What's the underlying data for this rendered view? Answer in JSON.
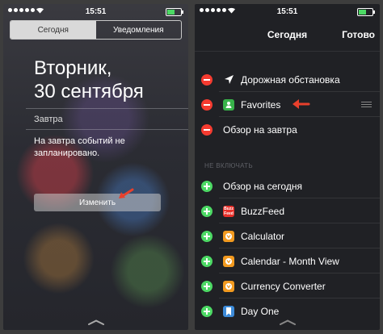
{
  "status_bar": {
    "time": "15:51"
  },
  "left_screen": {
    "tabs": [
      {
        "label": "Сегодня",
        "active": true
      },
      {
        "label": "Уведомления",
        "active": false
      }
    ],
    "date": {
      "weekday": "Вторник,",
      "day": "30 сентября"
    },
    "tomorrow": {
      "title": "Завтра",
      "message": "На завтра событий не запланировано."
    },
    "edit_button": "Изменить"
  },
  "right_screen": {
    "title": "Сегодня",
    "done_button": "Готово",
    "enabled_widgets": [
      {
        "label": "Дорожная обстановка",
        "icon": "location-arrow-icon"
      },
      {
        "label": "Favorites",
        "icon": "favorites-app-icon"
      },
      {
        "label": "Обзор на завтра",
        "icon": ""
      }
    ],
    "disabled_section_title": "НЕ ВКЛЮЧАТЬ",
    "disabled_widgets": [
      {
        "label": "Обзор на сегодня",
        "icon": ""
      },
      {
        "label": "BuzzFeed",
        "icon": "buzzfeed-app-icon",
        "icon_text": "Buzz Feed"
      },
      {
        "label": "Calculator",
        "icon": "calculator-app-icon"
      },
      {
        "label": "Calendar - Month View",
        "icon": "calendar-app-icon"
      },
      {
        "label": "Currency Converter",
        "icon": "currency-app-icon"
      },
      {
        "label": "Day One",
        "icon": "day-one-app-icon"
      }
    ]
  },
  "colors": {
    "delete": "#f53b30",
    "add": "#4cd964",
    "annotation_arrow": "#e8402c",
    "buzzfeed": "#e8302a",
    "orange_app": "#f29a1f",
    "favorites": "#38b34a",
    "day_one": "#3d8bd9"
  }
}
